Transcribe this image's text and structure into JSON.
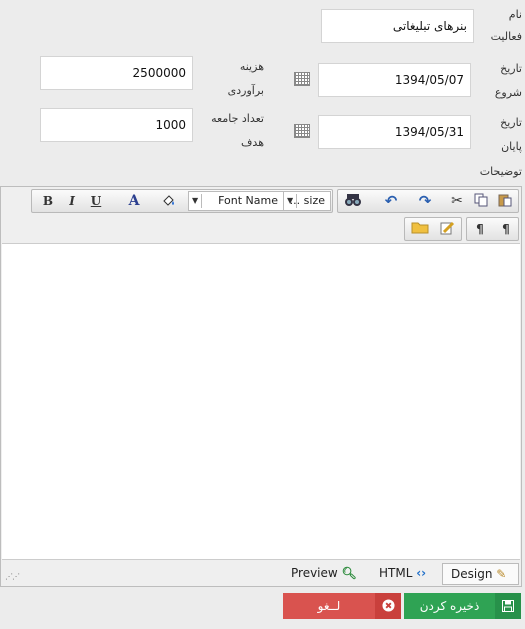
{
  "form": {
    "activity_name_label_1": "نام",
    "activity_name_label_2": "فعالیت",
    "activity_name_value": "بنرهای تبلیغاتی",
    "start_date_label_1": "تاریخ",
    "start_date_label_2": "شروع",
    "start_date_value": "1394/05/07",
    "end_date_label_1": "تاریخ",
    "end_date_label_2": "پایان",
    "end_date_value": "1394/05/31",
    "cost_label_1": "هزینه",
    "cost_label_2": "برآوردی",
    "cost_value": "2500000",
    "target_label_1": "تعداد جامعه",
    "target_label_2": "هدف",
    "target_value": "1000",
    "description_label": "توضیحات"
  },
  "editor": {
    "font_name": "Font Name",
    "font_size": "... size",
    "toolbar_icons": [
      "paste-icon",
      "copy-icon",
      "cut-icon",
      "redo-icon",
      "undo-icon",
      "find-icon",
      "fill-color-icon",
      "font-color-icon",
      "underline-icon",
      "italic-icon",
      "bold-icon",
      "ltr-icon",
      "rtl-icon",
      "image-manager-icon",
      "document-manager-icon"
    ],
    "bold": "B",
    "italic": "I",
    "underline": "U",
    "font_color": "A",
    "modes": {
      "design": "Design",
      "html": "HTML",
      "preview": "Preview"
    }
  },
  "actions": {
    "save_label": "ذخیره کردن",
    "cancel_label": "لــغو"
  },
  "colors": {
    "save": "#2fa354",
    "cancel": "#d9534f"
  }
}
